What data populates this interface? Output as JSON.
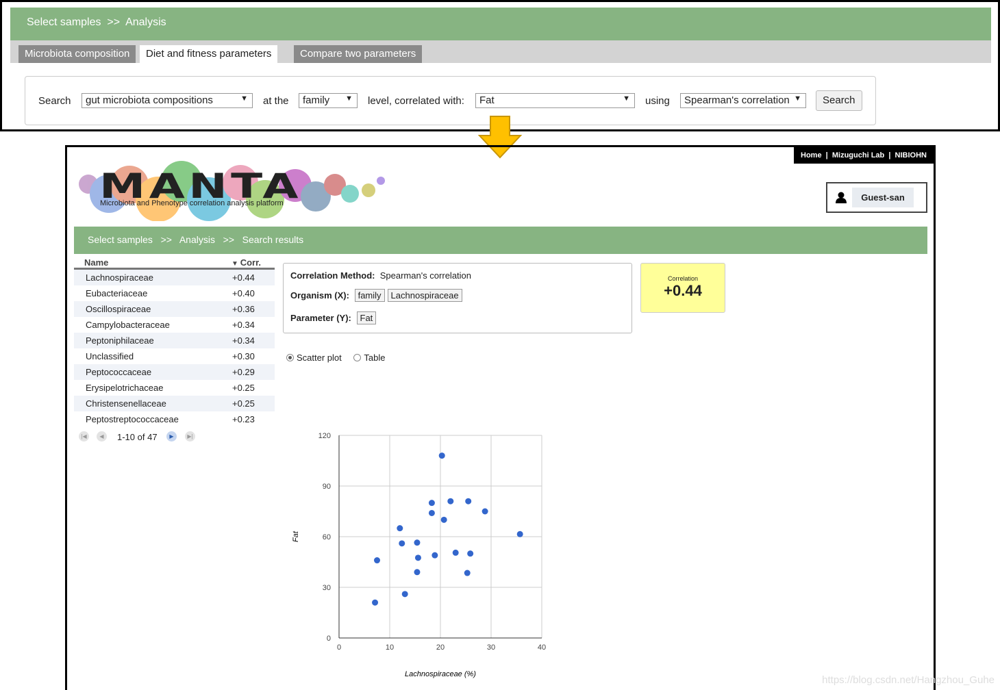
{
  "top": {
    "breadcrumb": "Select samples  >>  Analysis",
    "tabs": [
      {
        "label": "Microbiota composition"
      },
      {
        "label": "Diet and fitness parameters"
      },
      {
        "label": "Compare two parameters"
      }
    ],
    "search": {
      "label_search": "Search",
      "target": "gut microbiota compositions",
      "label_at": "at the",
      "level": "family",
      "label_level": "level, correlated with:",
      "parameter": "Fat",
      "label_using": "using",
      "method": "Spearman's correlation",
      "button": "Search"
    }
  },
  "main": {
    "toplinks": "Home  |  Mizuguchi Lab  |  NIBIOHN",
    "logo": {
      "title": "MANTA",
      "subtitle": "Microbiota and Phenotype correlation analysis platform"
    },
    "user": "Guest-san",
    "breadcrumb": "Select samples   >>   Analysis   >>   Search results",
    "list": {
      "col_name": "Name",
      "col_corr": "Corr.",
      "rows": [
        {
          "name": "Lachnospiraceae",
          "corr": "+0.44"
        },
        {
          "name": "Eubacteriaceae",
          "corr": "+0.40"
        },
        {
          "name": "Oscillospiraceae",
          "corr": "+0.36"
        },
        {
          "name": "Campylobacteraceae",
          "corr": "+0.34"
        },
        {
          "name": "Peptoniphilaceae",
          "corr": "+0.34"
        },
        {
          "name": "Unclassified",
          "corr": "+0.30"
        },
        {
          "name": "Peptococcaceae",
          "corr": "+0.29"
        },
        {
          "name": "Erysipelotrichaceae",
          "corr": "+0.25"
        },
        {
          "name": "Christensenellaceae",
          "corr": "+0.25"
        },
        {
          "name": "Peptostreptococcaceae",
          "corr": "+0.23"
        }
      ],
      "pager": "1-10 of 47"
    },
    "info": {
      "method_label": "Correlation Method:",
      "method": "Spearman's correlation",
      "organism_label": "Organism (X):",
      "organism_level": "family",
      "organism": "Lachnospiraceae",
      "param_label": "Parameter (Y):",
      "param": "Fat"
    },
    "correlation": {
      "label": "Correlation",
      "value": "+0.44"
    },
    "view": {
      "scatter": "Scatter plot",
      "table": "Table",
      "selected": "scatter"
    }
  },
  "chart_data": {
    "type": "scatter",
    "xlabel": "Lachnospiraceae (%)",
    "ylabel": "Fat",
    "xlim": [
      0,
      40
    ],
    "ylim": [
      0,
      120
    ],
    "xticks": [
      0,
      10,
      20,
      30,
      40
    ],
    "yticks": [
      0,
      30,
      60,
      90,
      120
    ],
    "grid": true,
    "color": "#3366cc",
    "points": [
      [
        7.1,
        21
      ],
      [
        7.5,
        46
      ],
      [
        12,
        65
      ],
      [
        12.4,
        56
      ],
      [
        13,
        26
      ],
      [
        15.4,
        56.5
      ],
      [
        15.6,
        47.5
      ],
      [
        15.4,
        39
      ],
      [
        18.3,
        80
      ],
      [
        18.3,
        74
      ],
      [
        18.9,
        49
      ],
      [
        20.3,
        108
      ],
      [
        20.7,
        70
      ],
      [
        22,
        81
      ],
      [
        23,
        50.5
      ],
      [
        25.5,
        81
      ],
      [
        25.9,
        50
      ],
      [
        25.3,
        38.5
      ],
      [
        28.8,
        75
      ],
      [
        35.7,
        61.5
      ]
    ]
  },
  "watermark": "https://blog.csdn.net/Hangzhou_Guhe"
}
